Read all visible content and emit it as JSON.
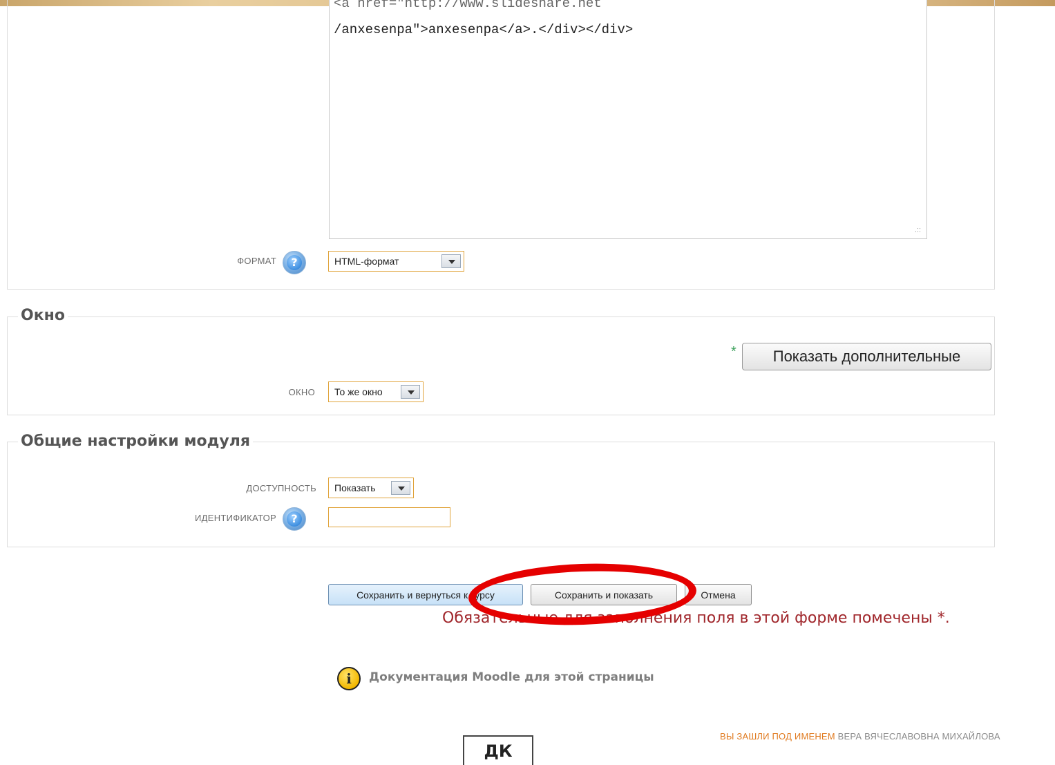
{
  "editor": {
    "line_cut": "<a href=\"http://www.slideshare.net",
    "line_2": "/anxesenpa\">anxesenpa</a>.</div></div>",
    "resize_glyph": ".::"
  },
  "format": {
    "label": "ФОРМАТ",
    "selected": "HTML-формат",
    "help_glyph": "?"
  },
  "window_section": {
    "legend": "Окно",
    "show_more_button": "Показать дополнительные",
    "star": "*",
    "field_label": "ОКНО",
    "selected": "То же окно"
  },
  "module_section": {
    "legend": "Общие настройки модуля",
    "availability_label": "ДОСТУПНОСТЬ",
    "availability_selected": "Показать",
    "id_label": "ИДЕНТИФИКАТОР",
    "id_value": "",
    "help_glyph": "?"
  },
  "actions": {
    "save_return": "Сохранить и вернуться к курсу",
    "save_show": "Сохранить и показать",
    "cancel": "Отмена"
  },
  "required_note": "Обязательные для заполнения поля в этой форме помечены *.",
  "docs": {
    "icon_glyph": "i",
    "link": "Документация Moodle для этой страницы"
  },
  "login": {
    "prefix": "ВЫ ЗАШЛИ ПОД ИМЕНЕМ",
    "name": "ВЕРА ВЯЧЕСЛАВОВНА МИХАЙЛОВА"
  },
  "footer_tab": "ДК",
  "colors": {
    "accent_border": "#e0a33a",
    "required_text": "#a0262b",
    "highlight": "#e50000",
    "login_prefix": "#e07a1f"
  }
}
